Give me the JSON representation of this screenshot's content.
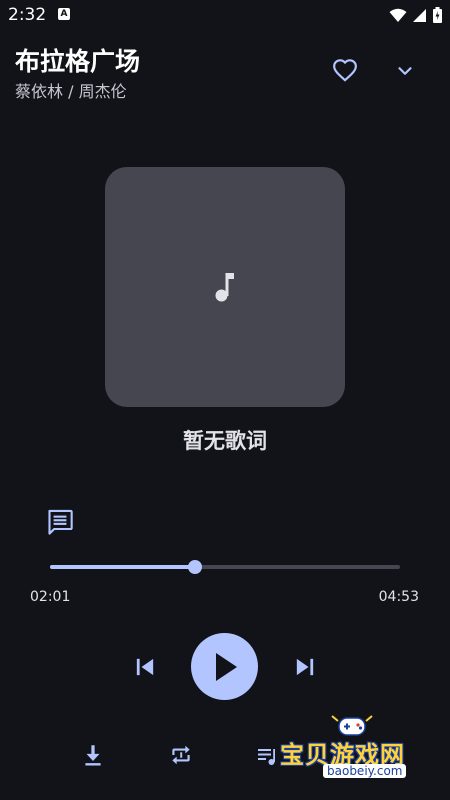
{
  "status_bar": {
    "time": "2:32",
    "app_badge": "A"
  },
  "song": {
    "title": "布拉格广场",
    "artist": "蔡依林 / 周杰伦"
  },
  "cover": {
    "icon": "music-note-icon",
    "bg_color": "#45464f"
  },
  "lyrics": {
    "placeholder": "暂无歌词"
  },
  "progress": {
    "current": "02:01",
    "duration": "04:53",
    "fraction": 0.414
  },
  "controls": {
    "top": [
      "heart-icon",
      "chevron-down-icon"
    ],
    "main": [
      "skip-previous-icon",
      "play-icon",
      "skip-next-icon"
    ],
    "bottom": [
      "download-icon",
      "repeat-one-icon",
      "playlist-icon"
    ]
  },
  "watermark": {
    "text": "宝贝游戏网",
    "url": "baobeiy.com"
  },
  "colors": {
    "background": "#121318",
    "accent": "#b2c5ff",
    "track": "#45464f"
  }
}
